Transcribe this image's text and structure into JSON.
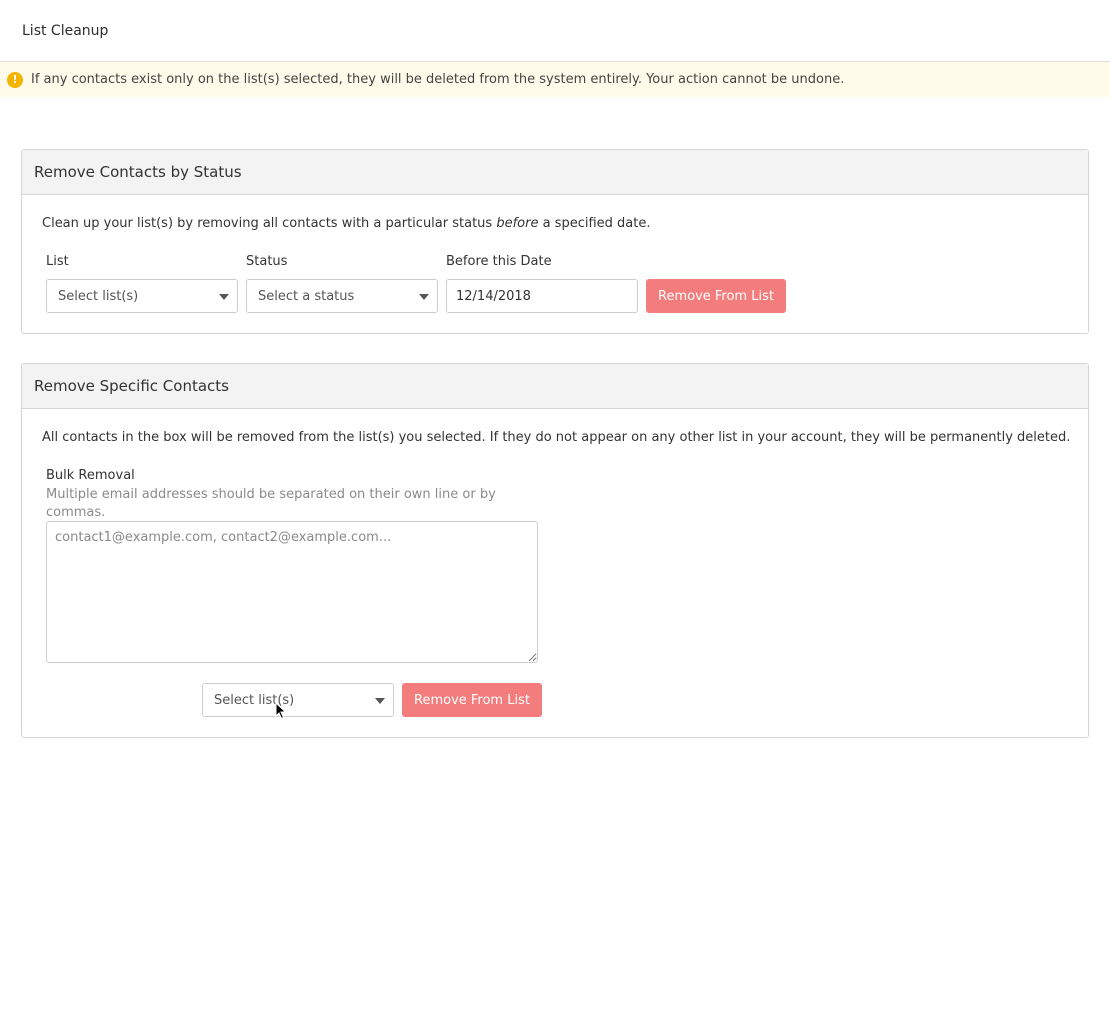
{
  "header": {
    "title": "List Cleanup"
  },
  "warning": {
    "icon": "exclamation-icon",
    "text": "If any contacts exist only on the list(s) selected, they will be deleted from the system entirely. Your action cannot be undone."
  },
  "by_status": {
    "title": "Remove Contacts by Status",
    "desc_before": "Clean up your list(s) by removing all contacts with a particular status ",
    "desc_em": "before",
    "desc_after": " a specified date.",
    "list_label": "List",
    "list_placeholder": "Select list(s)",
    "status_label": "Status",
    "status_placeholder": "Select a status",
    "date_label": "Before this Date",
    "date_value": "12/14/2018",
    "button_label": "Remove From List"
  },
  "specific": {
    "title": "Remove Specific Contacts",
    "desc": "All contacts in the box will be removed from the list(s) you selected. If they do not appear on any other list in your account, they will be permanently deleted.",
    "bulk_label": "Bulk Removal",
    "bulk_help": "Multiple email addresses should be separated on their own line or by commas.",
    "textarea_placeholder": "contact1@example.com, contact2@example.com...",
    "list_placeholder": "Select list(s)",
    "button_label": "Remove From List"
  },
  "colors": {
    "accent_button": "#f37c7c",
    "warning_bg": "#fffbea",
    "warning_icon": "#f5b400"
  }
}
